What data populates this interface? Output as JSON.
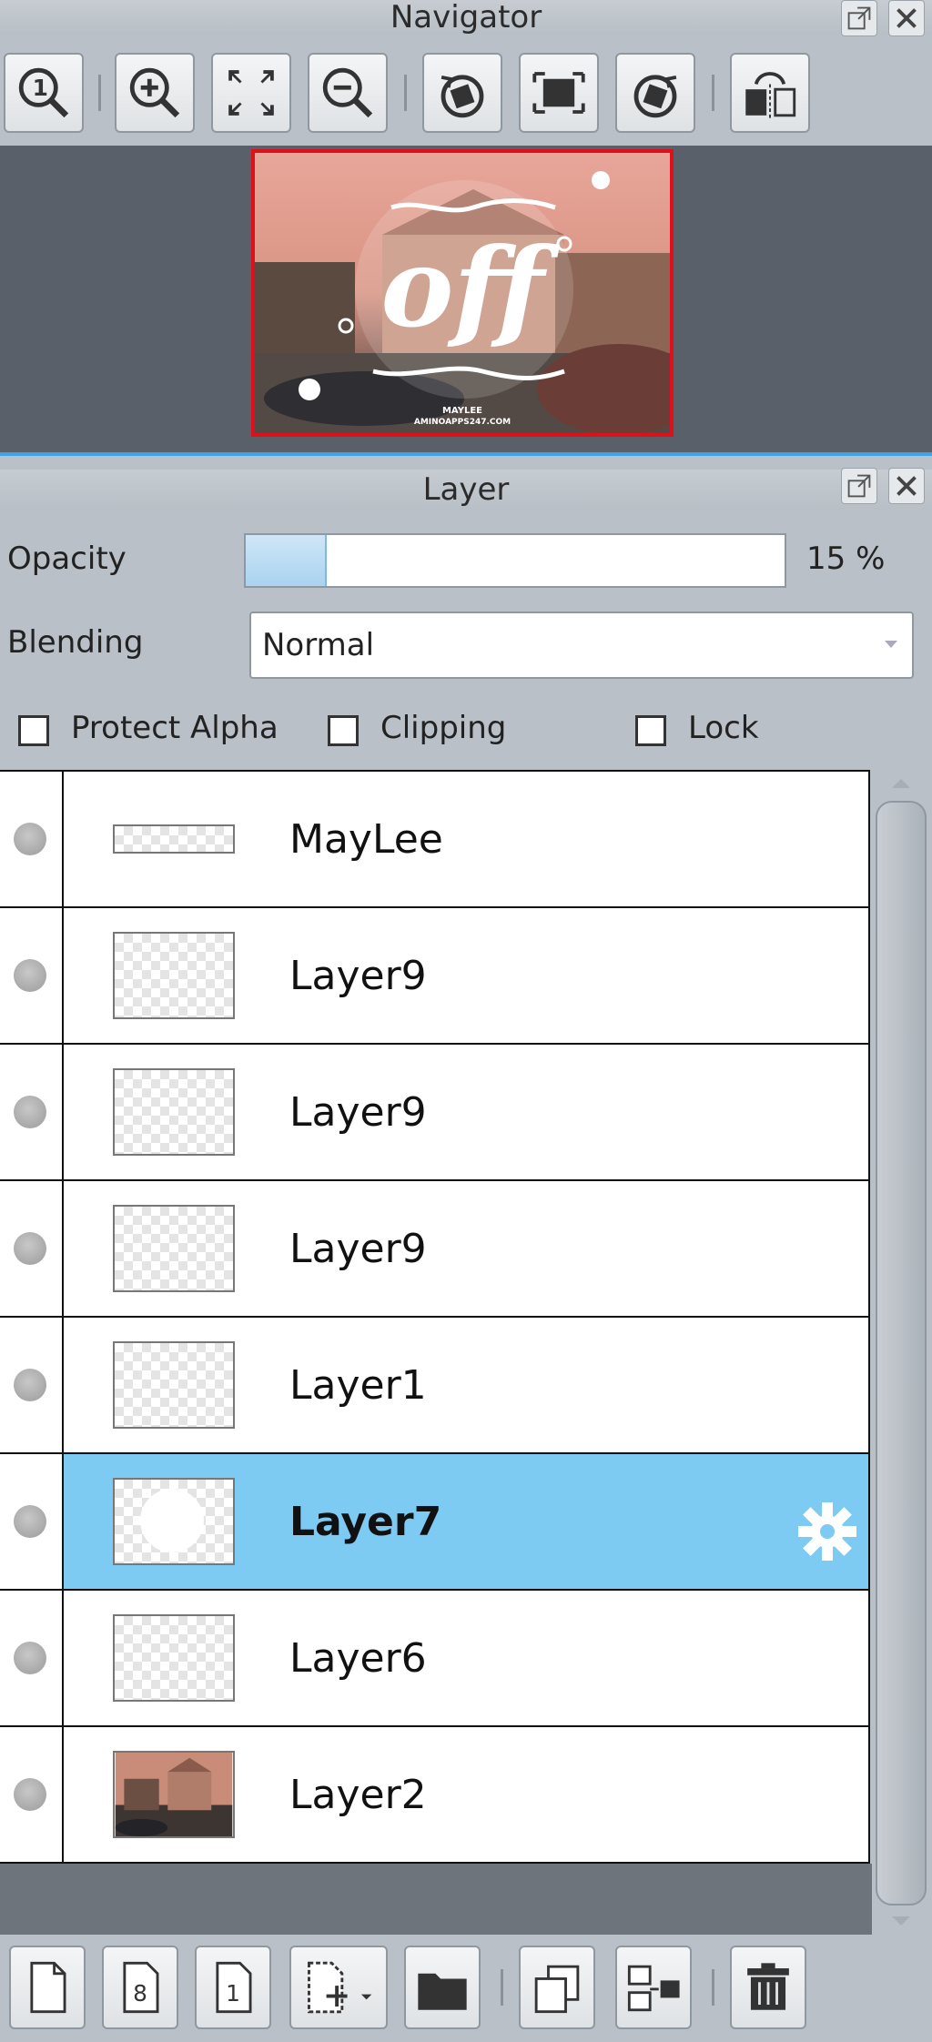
{
  "navigator": {
    "title": "Navigator",
    "preview": {
      "text_main": "off",
      "text_small1": "MAYLEE",
      "text_small2": "AMINOAPPS247.COM"
    }
  },
  "layer_panel": {
    "title": "Layer",
    "opacity_label": "Opacity",
    "opacity_value": 15,
    "opacity_text": "15 %",
    "blending_label": "Blending",
    "blending_value": "Normal",
    "protect_alpha_label": "Protect Alpha",
    "clipping_label": "Clipping",
    "lock_label": "Lock",
    "layers": [
      {
        "name": "MayLee"
      },
      {
        "name": "Layer9"
      },
      {
        "name": "Layer9"
      },
      {
        "name": "Layer9"
      },
      {
        "name": "Layer1"
      },
      {
        "name": "Layer7",
        "selected": true
      },
      {
        "name": "Layer6"
      },
      {
        "name": "Layer2"
      }
    ]
  },
  "colors": {
    "selected_row": "#7dcaf3",
    "nav_border": "#e0101a"
  }
}
